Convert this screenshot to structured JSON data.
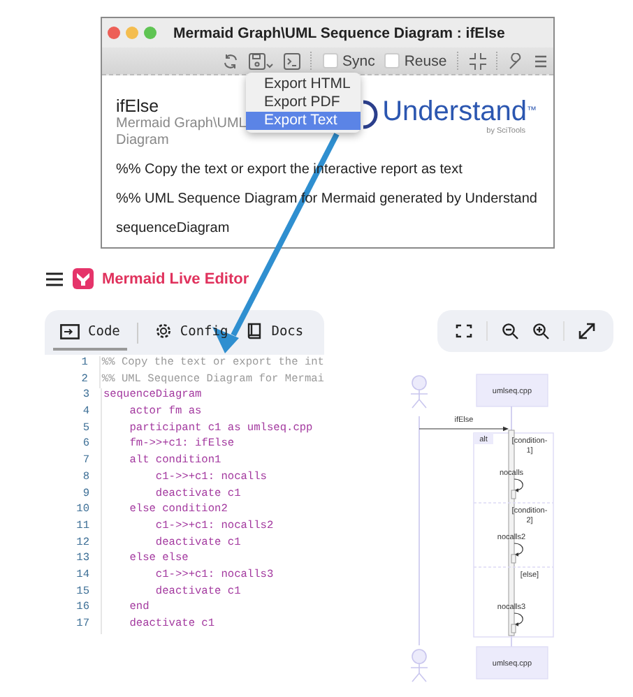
{
  "report_window": {
    "title": "Mermaid Graph\\UML Sequence Diagram : ifElse",
    "toolbar": {
      "checkboxes": [
        {
          "label": "Sync",
          "checked": false
        },
        {
          "label": "Reuse",
          "checked": false
        }
      ]
    },
    "export_menu": [
      {
        "label": "Export HTML",
        "selected": false
      },
      {
        "label": "Export PDF",
        "selected": false
      },
      {
        "label": "Export Text",
        "selected": true
      }
    ],
    "heading": "ifElse",
    "subtitle_lines": [
      "Mermaid Graph\\UML",
      "Diagram"
    ],
    "logo": {
      "name": "Understand",
      "trademark": "™",
      "byline": "by SciTools"
    },
    "lines": [
      "%% Copy the text or export the interactive report as text",
      "%% UML Sequence Diagram for Mermaid generated by Understand",
      "sequenceDiagram"
    ]
  },
  "editor": {
    "app_title": "Mermaid Live Editor",
    "tabs": [
      {
        "label": "Code",
        "selected": true,
        "kind": "code"
      },
      {
        "label": "Config",
        "selected": false,
        "kind": "config"
      },
      {
        "label": "Docs",
        "selected": false,
        "kind": "docs"
      }
    ],
    "code_lines": [
      {
        "number": "1",
        "text": "%% Copy the text or export the int",
        "kind": "comment"
      },
      {
        "number": "2",
        "text": "%% UML Sequence Diagram for Mermai",
        "kind": "comment"
      },
      {
        "number": "3",
        "text": "sequenceDiagram",
        "kind": "code"
      },
      {
        "number": "4",
        "text": "    actor fm as",
        "kind": "code"
      },
      {
        "number": "5",
        "text": "    participant c1 as umlseq.cpp",
        "kind": "code"
      },
      {
        "number": "6",
        "text": "    fm->>+c1: ifElse",
        "kind": "code"
      },
      {
        "number": "7",
        "text": "    alt condition1",
        "kind": "code"
      },
      {
        "number": "8",
        "text": "        c1->>+c1: nocalls",
        "kind": "code"
      },
      {
        "number": "9",
        "text": "        deactivate c1",
        "kind": "code"
      },
      {
        "number": "10",
        "text": "    else condition2",
        "kind": "code"
      },
      {
        "number": "11",
        "text": "        c1->>+c1: nocalls2",
        "kind": "code"
      },
      {
        "number": "12",
        "text": "        deactivate c1",
        "kind": "code"
      },
      {
        "number": "13",
        "text": "    else else",
        "kind": "code"
      },
      {
        "number": "14",
        "text": "        c1->>+c1: nocalls3",
        "kind": "code"
      },
      {
        "number": "15",
        "text": "        deactivate c1",
        "kind": "code"
      },
      {
        "number": "16",
        "text": "    end",
        "kind": "code"
      },
      {
        "number": "17",
        "text": "    deactivate c1",
        "kind": "code"
      }
    ]
  },
  "diagram": {
    "participant_top": "umlseq.cpp",
    "participant_bottom": "umlseq.cpp",
    "message": "ifElse",
    "frame_label": "alt",
    "sections": [
      {
        "condition_lines": [
          "[condition-",
          "1]"
        ],
        "self_message": "nocalls"
      },
      {
        "condition_lines": [
          "[condition-",
          "2]"
        ],
        "self_message": "nocalls2"
      },
      {
        "condition_lines": [
          "[else]"
        ],
        "self_message": "nocalls3"
      }
    ]
  }
}
